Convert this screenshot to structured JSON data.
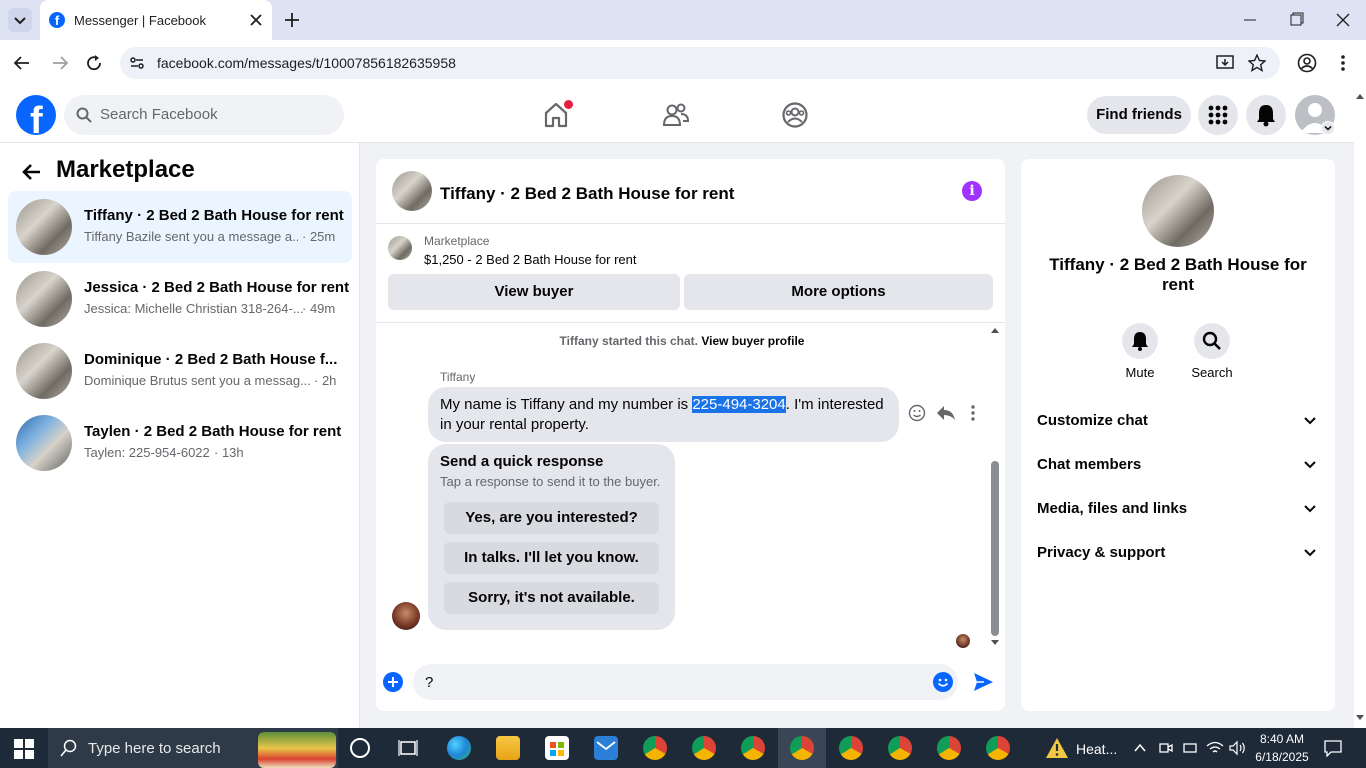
{
  "browser": {
    "tab_title": "Messenger | Facebook",
    "url": "facebook.com/messages/t/10007856182635958"
  },
  "fb": {
    "search_placeholder": "Search Facebook",
    "find_friends": "Find friends",
    "brand_color": "#0866ff"
  },
  "sidebar": {
    "title": "Marketplace",
    "conversations": [
      {
        "title": "Tiffany · 2 Bed 2 Bath House for rent",
        "preview": "Tiffany Bazile sent you a message a...",
        "time": "· 25m"
      },
      {
        "title": "Jessica · 2 Bed 2 Bath House for rent",
        "preview": "Jessica: Michelle Christian 318-264-...",
        "time": "· 49m"
      },
      {
        "title": "Dominique · 2 Bed 2 Bath House f...",
        "preview": "Dominique Brutus sent you a messag...",
        "time": "· 2h"
      },
      {
        "title": "Taylen · 2 Bed 2 Bath House for rent",
        "preview": "Taylen: 225-954-6022",
        "time": "· 13h"
      }
    ]
  },
  "chat": {
    "title": "Tiffany · 2 Bed 2 Bath House for rent",
    "listing_source": "Marketplace",
    "listing": "$1,250 - 2 Bed 2 Bath House for rent",
    "view_buyer": "View buyer",
    "more_options": "More options",
    "started_text": "Tiffany started this chat.",
    "view_profile": "View buyer profile",
    "sender": "Tiffany",
    "msg_part1": "My name is Tiffany and my number is ",
    "msg_phone": "225-494-3204",
    "msg_part2": ". I'm interested in your rental property.",
    "quick_title": "Send a quick response",
    "quick_sub": "Tap a response to send it to the buyer.",
    "quick_responses": [
      "Yes, are you interested?",
      "In talks. I'll let you know.",
      "Sorry, it's not available."
    ],
    "input_value": "?"
  },
  "info": {
    "title": "Tiffany · 2 Bed 2 Bath House for rent",
    "mute": "Mute",
    "search": "Search",
    "sections": [
      "Customize chat",
      "Chat members",
      "Media, files and links",
      "Privacy & support"
    ]
  },
  "taskbar": {
    "search_placeholder": "Type here to search",
    "weather": "Heat...",
    "time": "8:40 AM",
    "date": "6/18/2025"
  }
}
